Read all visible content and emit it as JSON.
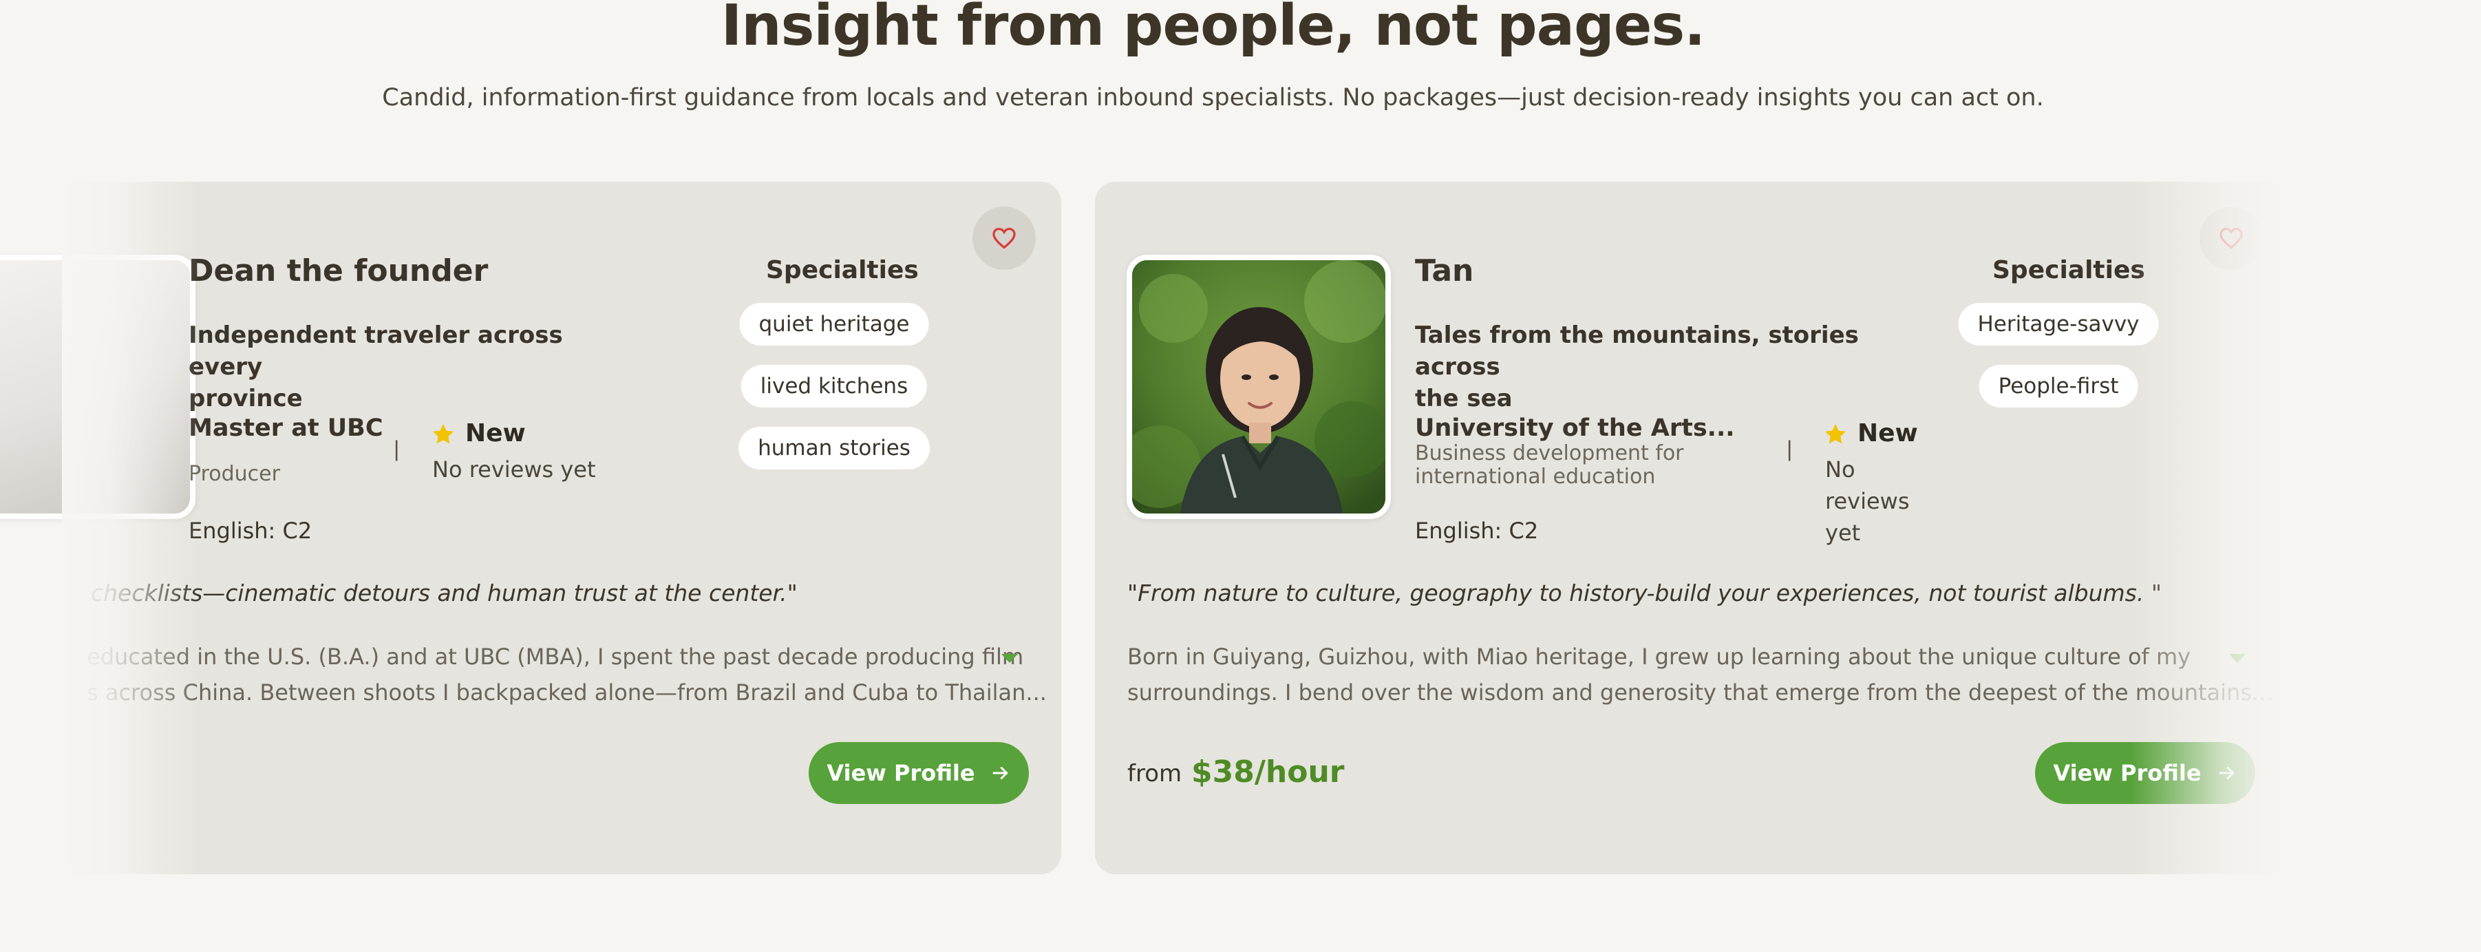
{
  "header": {
    "title": "Insight from people, not pages.",
    "subtitle": "Candid, information-first guidance from locals and veteran inbound specialists. No packages—just decision-ready insights you can act on."
  },
  "cards": [
    {
      "name": "Dean the founder",
      "tagline_line1": "Independent traveler across every",
      "tagline_line2": "province",
      "education": "Master at UBC",
      "role": "Producer",
      "divider": "|",
      "rating_label": "New",
      "reviews": "No reviews yet",
      "language": "English: C2",
      "specialties_title": "Specialties",
      "specialties": [
        "quiet heritage",
        "lived kitchens",
        "human stories"
      ],
      "quote": "checklists—cinematic detours and human trust at the center.\"",
      "bio_line1": "educated in the U.S. (B.A.) and at UBC (MBA), I spent the past decade producing film",
      "bio_line2": "s across China. Between shoots I backpacked alone—from Brazil and Cuba to Thailan...",
      "button": "View Profile"
    },
    {
      "name": "Tan",
      "tagline_line1": "Tales from the mountains, stories across",
      "tagline_line2": "the sea",
      "education": "University of the Arts...",
      "role_line1": "Business development for",
      "role_line2": "international education",
      "divider": "|",
      "rating_label": "New",
      "reviews_line1": "No",
      "reviews_line2": "reviews",
      "reviews_line3": "yet",
      "language": "English: C2",
      "specialties_title": "Specialties",
      "specialties": [
        "Heritage-savvy",
        "People-first"
      ],
      "quote": "\"From nature to culture, geography to history-build your experiences, not tourist albums. \"",
      "bio_line1": "Born in Guiyang, Guizhou, with Miao heritage, I grew up learning about the unique culture of my",
      "bio_line2": "surroundings. I bend over the wisdom and generosity that emerge from the deepest of the mountains...",
      "from_label": "from",
      "price": "$38/hour",
      "button": "View Profile"
    }
  ],
  "icons": {
    "favorite": "heart-outline-icon",
    "rating": "star-icon",
    "expand": "caret-down-icon",
    "button_arrow": "arrow-right-icon"
  },
  "colors": {
    "accent_green": "#57a23a",
    "price_green": "#4e8b25",
    "star_yellow": "#f2c200",
    "heart_red": "#d83a3a",
    "card_bg": "#e6e4de",
    "page_bg": "#f6f5f1"
  }
}
